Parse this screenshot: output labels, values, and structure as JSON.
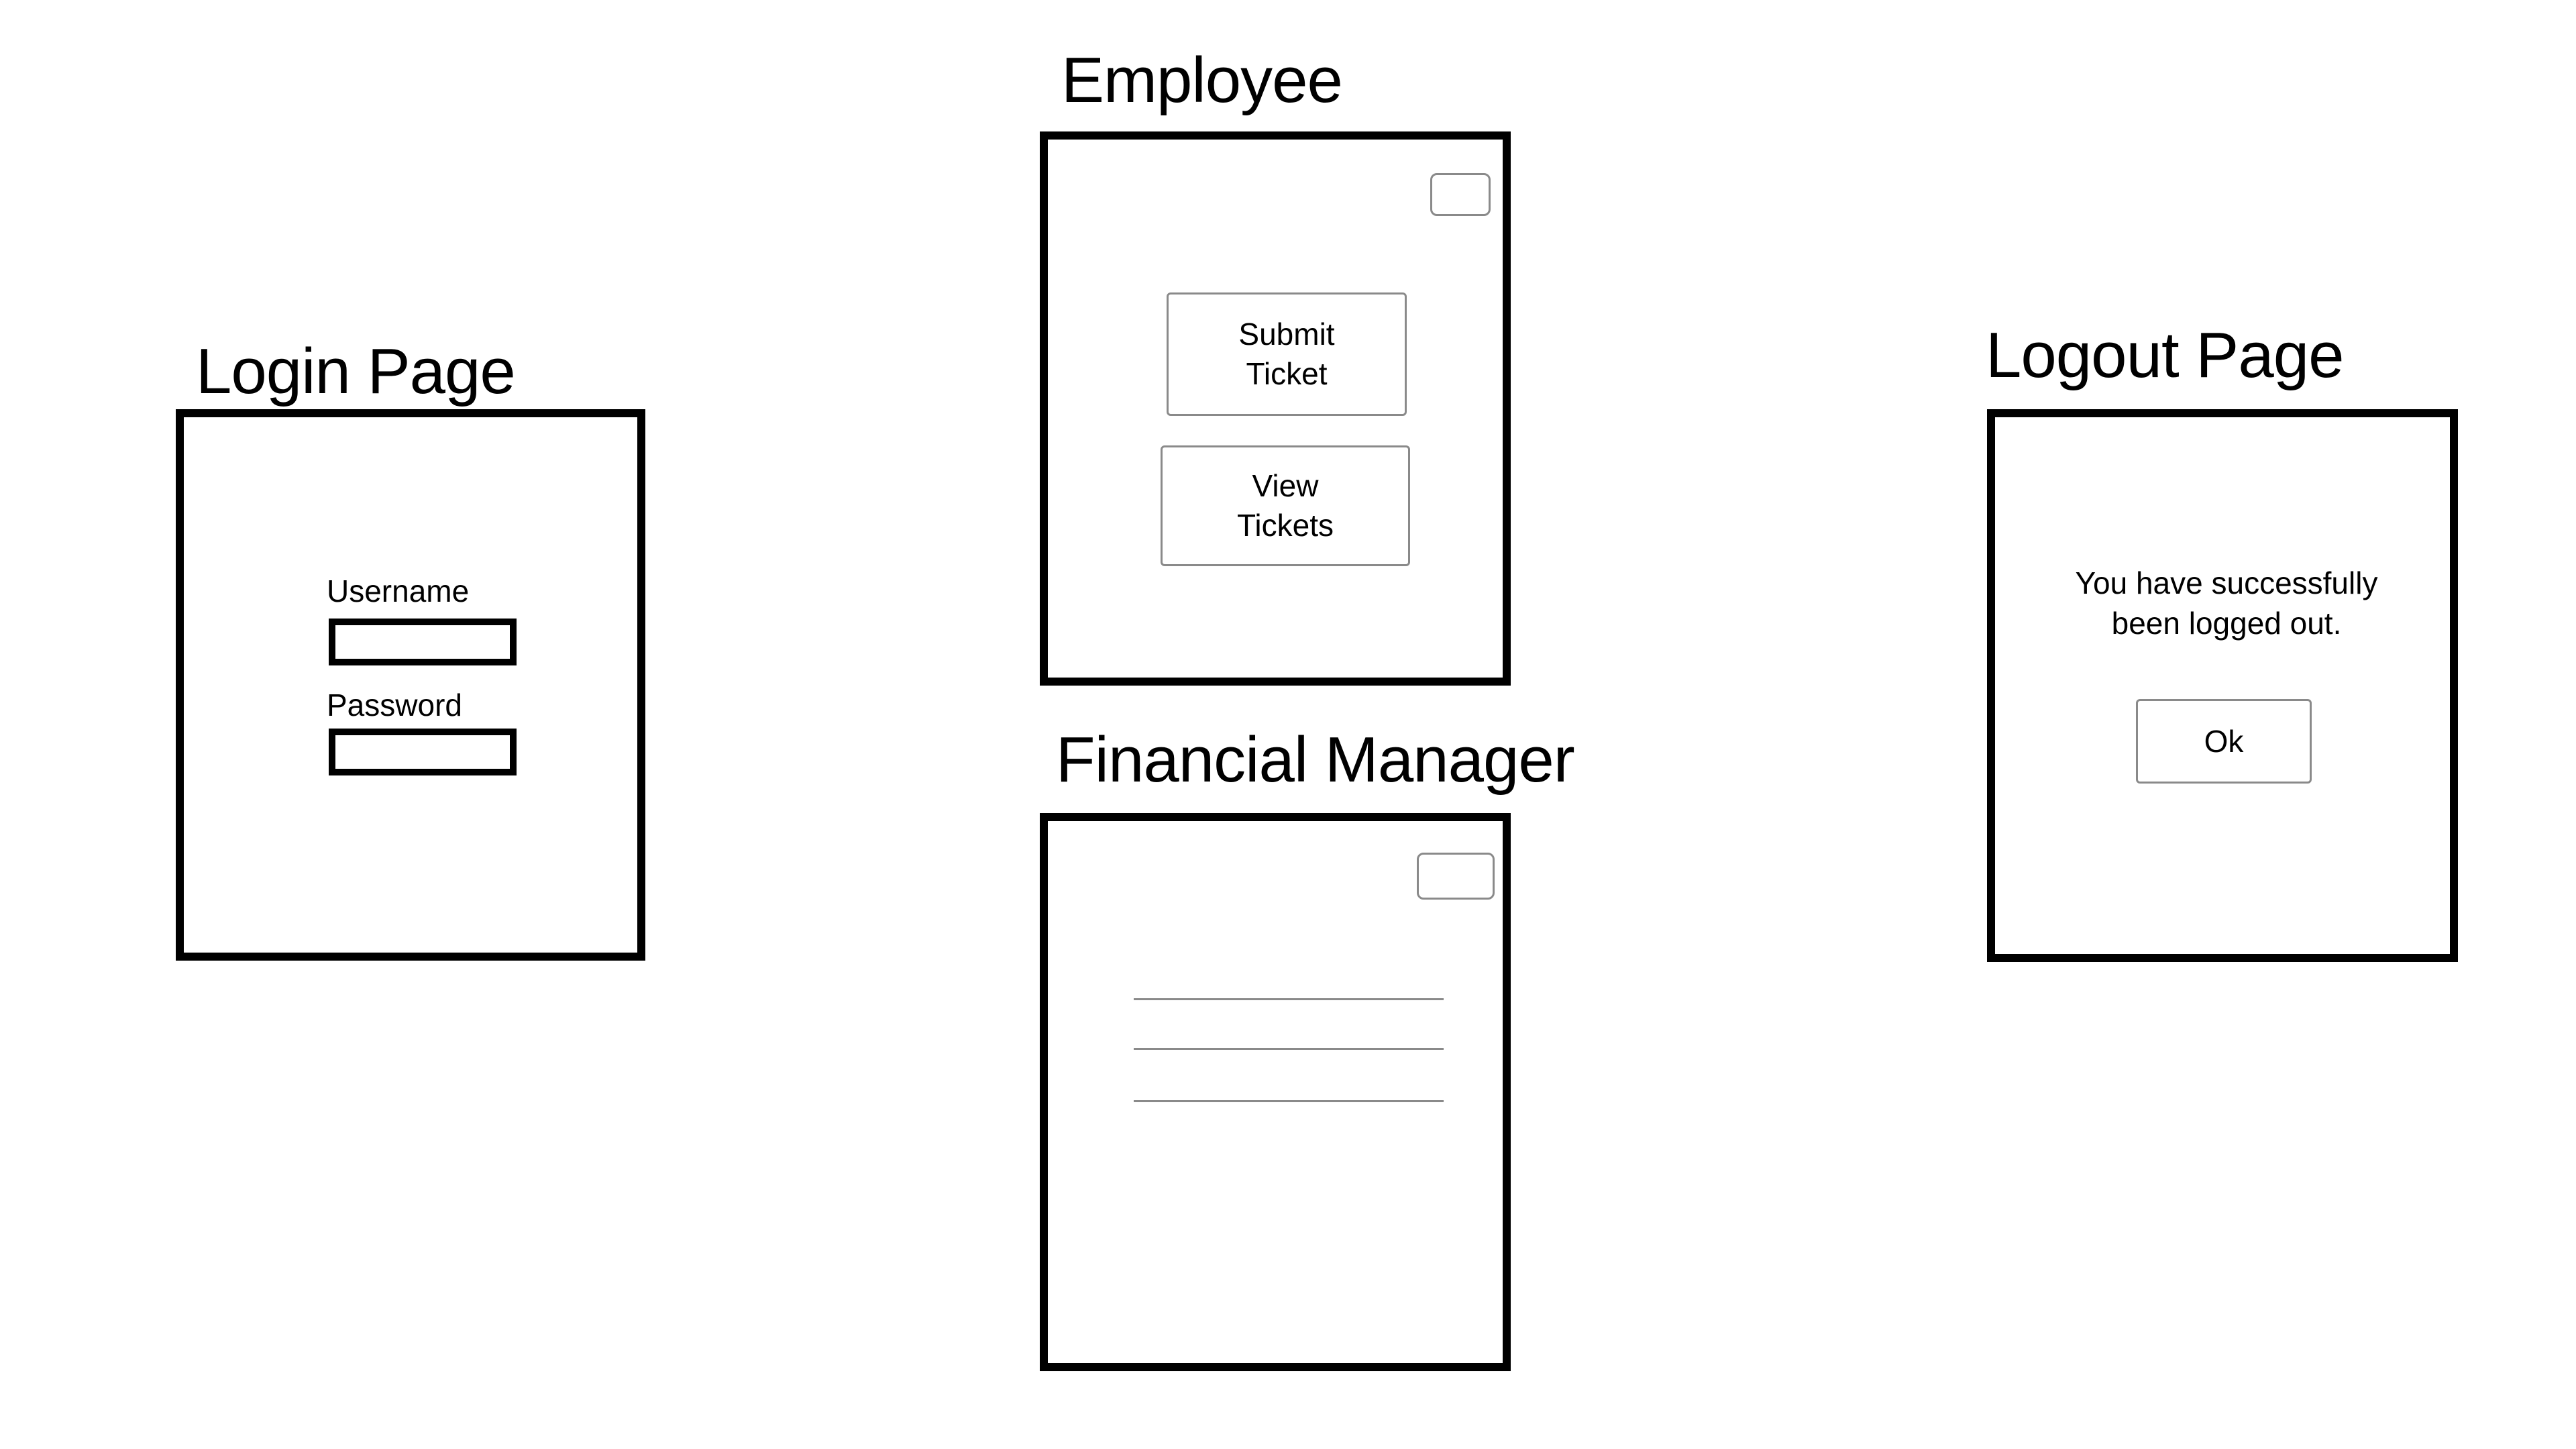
{
  "login": {
    "heading": "Login Page",
    "username_label": "Username",
    "username_value": "",
    "password_label": "Password",
    "password_value": ""
  },
  "employee": {
    "heading": "Employee",
    "submit_ticket_label": "Submit\nTicket",
    "view_tickets_label": "View\nTickets"
  },
  "financial_manager": {
    "heading": "Financial Manager",
    "list_item_count": 3
  },
  "logout": {
    "heading": "Logout Page",
    "message": "You have successfully\nbeen logged out.",
    "ok_label": "Ok"
  }
}
